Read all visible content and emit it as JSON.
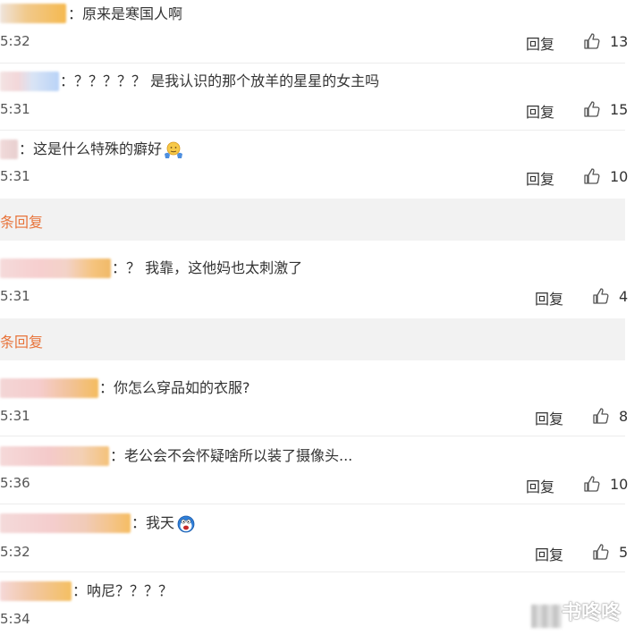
{
  "comments": [
    {
      "text": "：原来是寒国人啊",
      "time": "5:32",
      "reply": "回复",
      "likes": "13"
    },
    {
      "text": "：？？？？？ 是我认识的那个放羊的星星的女主吗",
      "time": "5:31",
      "reply": "回复",
      "likes": "15"
    },
    {
      "text": "：这是什么特殊的癖好",
      "time": "5:31",
      "reply": "回复",
      "likes": "10",
      "emoji": "shrug-emoji"
    },
    {
      "text": "：？ 我靠，这他妈也太刺激了",
      "time": "5:31",
      "reply": "回复",
      "likes": "4"
    },
    {
      "text": "：你怎么穿品如的衣服?",
      "time": "5:31",
      "reply": "回复",
      "likes": "8"
    },
    {
      "text": "：老公会不会怀疑啥所以装了摄像头...",
      "time": "5:36",
      "reply": "回复",
      "likes": "10"
    },
    {
      "text": "：我天",
      "time": "5:32",
      "reply": "回复",
      "likes": "5",
      "emoji": "shocked-emoji"
    },
    {
      "text": "：呐尼？？？？",
      "time": "5:34"
    }
  ],
  "more_replies": [
    {
      "text": "条回复"
    },
    {
      "text": "条回复"
    }
  ],
  "watermark": {
    "text": "书咚咚"
  },
  "colors": {
    "accent": "#e8743b",
    "more_bar_bg": "#f2f2f2",
    "text": "#333333",
    "divider": "#ececec"
  }
}
